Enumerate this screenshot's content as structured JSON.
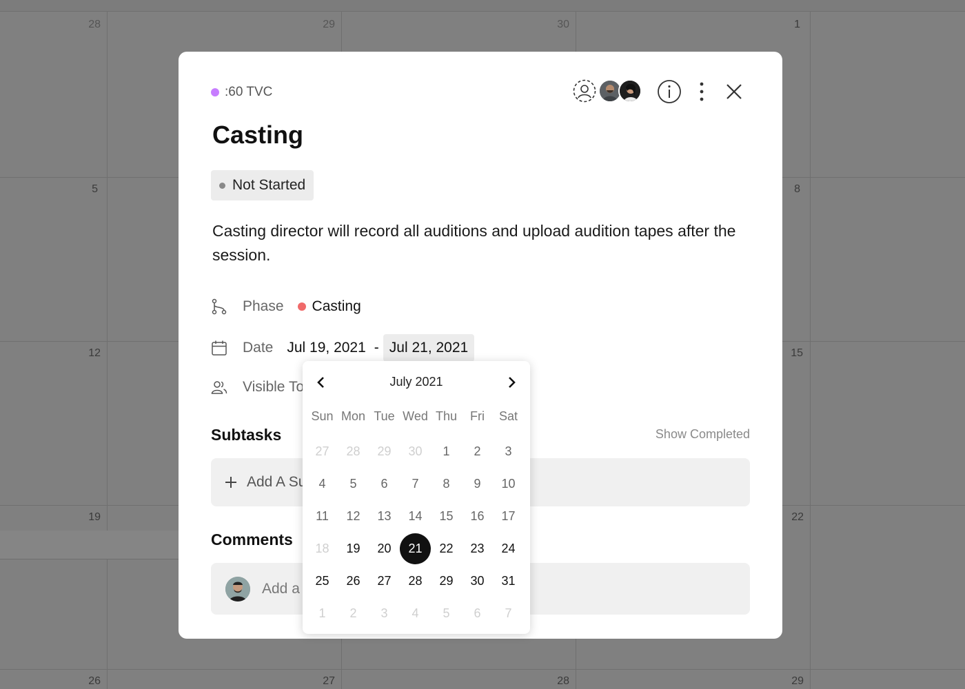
{
  "background_calendar": {
    "day_numbers": [
      "28",
      "29",
      "30",
      "1",
      "5",
      "8",
      "12",
      "15",
      "19",
      "22",
      "26",
      "27",
      "28",
      "29"
    ]
  },
  "task": {
    "project": ":60 TVC",
    "title": "Casting",
    "status": "Not Started",
    "description": "Casting director will record all auditions and upload audition tapes after the session.",
    "phase_label": "Phase",
    "phase_value": "Casting",
    "date_label": "Date",
    "date_start": "Jul 19, 2021",
    "date_separator": "-",
    "date_end": "Jul 21, 2021",
    "visible_to_label": "Visible To",
    "subtasks_title": "Subtasks",
    "show_completed": "Show Completed",
    "add_subtask": "Add A Subtask",
    "comments_title": "Comments",
    "comment_placeholder": "Add a comment"
  },
  "datepicker": {
    "month": "July 2021",
    "weekdays": [
      "Sun",
      "Mon",
      "Tue",
      "Wed",
      "Thu",
      "Fri",
      "Sat"
    ],
    "weeks": [
      [
        "27",
        "28",
        "29",
        "30",
        "1",
        "2",
        "3"
      ],
      [
        "4",
        "5",
        "6",
        "7",
        "8",
        "9",
        "10"
      ],
      [
        "11",
        "12",
        "13",
        "14",
        "15",
        "16",
        "17"
      ],
      [
        "18",
        "19",
        "20",
        "21",
        "22",
        "23",
        "24"
      ],
      [
        "25",
        "26",
        "27",
        "28",
        "29",
        "30",
        "31"
      ],
      [
        "1",
        "2",
        "3",
        "4",
        "5",
        "6",
        "7"
      ]
    ],
    "selected": "21"
  },
  "colors": {
    "project_dot": "#c77dff",
    "phase_dot": "#f06a6a",
    "status_dot": "#888888",
    "selected_day_bg": "#111111"
  }
}
